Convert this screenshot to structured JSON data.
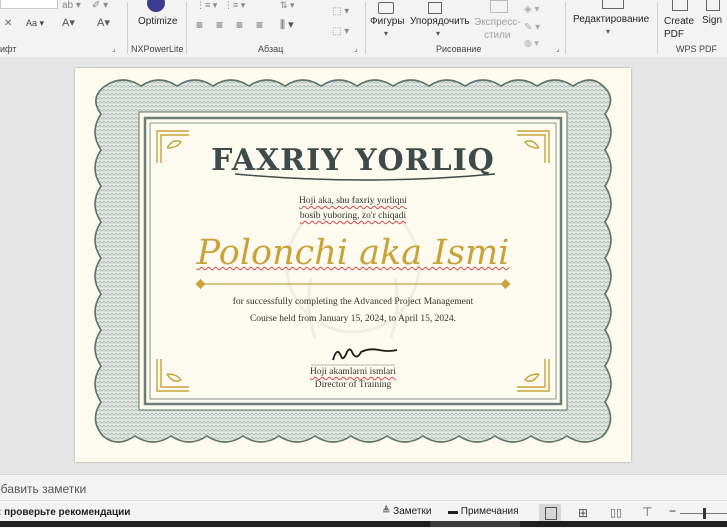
{
  "ribbon": {
    "font_group_label": "ифт",
    "font_size_label": "Aa",
    "nxpowerlite": {
      "button_label": "Optimize",
      "group_label": "NXPowerLite"
    },
    "paragraph_group_label": "Абзац",
    "drawing": {
      "shapes_label": "Фигуры",
      "arrange_label": "Упорядочить",
      "quick_styles_label": "Экспресс-\nстили",
      "group_label": "Рисование"
    },
    "editing_label": "Редактирование",
    "wps": {
      "create_pdf_label": "Create\nPDF",
      "sign_label": "Sign",
      "group_label": "WPS PDF"
    }
  },
  "slide": {
    "title": "FAXRIY YORLIQ",
    "subtitle_line1": "Hoji aka, shu faxriy yorliqni",
    "subtitle_line2": "bosib yuboring, zo'r chiqadi",
    "recipient_name": "Polonchi aka Ismi",
    "body_line1": "for successfully completing the Advanced Project Management",
    "body_line2": "Course held from January 15, 2024, to April 15, 2024.",
    "signer_name": "Hoji akamlarni ismlari",
    "signer_title": "Director of Training"
  },
  "notes": {
    "placeholder": "обавить заметки"
  },
  "status": {
    "message": ": проверьте рекомендации",
    "notes_label": "Заметки",
    "comments_label": "Примечания"
  },
  "colors": {
    "border_green": "#6b7f78",
    "gold": "#c8a33a",
    "title_color": "#3d4b4a",
    "slide_bg": "#fdfbf0"
  }
}
